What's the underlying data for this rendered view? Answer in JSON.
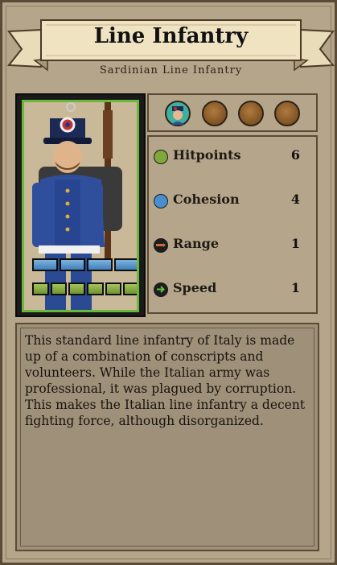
{
  "unit": {
    "name": "Line Infantry",
    "subtitle": "Sardinian Line Infantry"
  },
  "traits": [
    {
      "icon": "italian-officer-trait-icon",
      "filled": true
    },
    {
      "icon": "empty-trait-slot-icon",
      "filled": false
    },
    {
      "icon": "empty-trait-slot-icon",
      "filled": false
    },
    {
      "icon": "empty-trait-slot-icon",
      "filled": false
    }
  ],
  "stats": [
    {
      "label": "Hitpoints",
      "value": "6",
      "icon": "hitpoints-icon",
      "color": "#7fa83a"
    },
    {
      "label": "Cohesion",
      "value": "4",
      "icon": "cohesion-icon",
      "color": "#4a8ed0"
    },
    {
      "label": "Range",
      "value": "1",
      "icon": "range-icon",
      "color": "#c24a2a"
    },
    {
      "label": "Speed",
      "value": "1",
      "icon": "speed-icon",
      "color": "#3a9a3a"
    }
  ],
  "portrait_bars": {
    "cohesion_segments": 4,
    "hitpoint_segments": 6
  },
  "description": "This standard line infantry of Italy is made up of a combination of conscripts and volunteers. While the Italian army was professional, it was plagued by corruption. This makes the Italian line infantry a decent fighting force, although disorganized."
}
